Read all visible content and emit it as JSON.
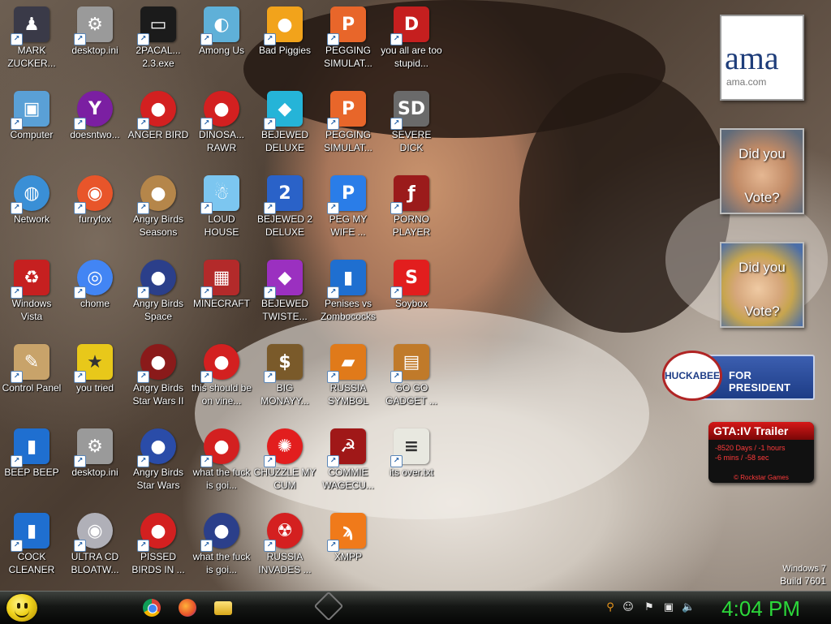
{
  "desktop": {
    "icons": [
      {
        "label": "MARK ZUCKER...",
        "icon": "hooded-figure-icon",
        "color": "#3a3a48",
        "glyph": "♟"
      },
      {
        "label": "desktop.ini",
        "icon": "ini-file-icon",
        "color": "#9a9a9a",
        "glyph": "⚙"
      },
      {
        "label": "2PACAL... 2.3.exe",
        "icon": "console-icon",
        "color": "#1b1b1b",
        "glyph": "▭"
      },
      {
        "label": "Among Us",
        "icon": "among-us-icon",
        "color": "#5fb0d8",
        "glyph": "◐"
      },
      {
        "label": "Bad Piggies",
        "icon": "bad-piggies-icon",
        "color": "#f2a31b",
        "glyph": "●"
      },
      {
        "label": "PEGGING SIMULAT...",
        "icon": "pegging-icon",
        "color": "#e8662a",
        "glyph": "P"
      },
      {
        "label": "you all are too stupid...",
        "icon": "dev-cpp-icon",
        "color": "#c51f1f",
        "glyph": "D"
      },
      {
        "label": "Computer",
        "icon": "computer-icon",
        "color": "#5aa0d6",
        "glyph": "▣"
      },
      {
        "label": "doesntwo...",
        "icon": "yahoo-messenger-icon",
        "color": "#7b1fa2",
        "glyph": "Y"
      },
      {
        "label": "ANGER BIRD",
        "icon": "angry-bird-icon",
        "color": "#d32020",
        "glyph": "●"
      },
      {
        "label": "DINOSA... RAWR",
        "icon": "angry-bird-icon",
        "color": "#d32020",
        "glyph": "●"
      },
      {
        "label": "BEJEWED DELUXE",
        "icon": "gem-icon",
        "color": "#25b4d8",
        "glyph": "◆"
      },
      {
        "label": "PEGGING SIMULAT...",
        "icon": "pegging-icon",
        "color": "#e8662a",
        "glyph": "P"
      },
      {
        "label": "SEVERE DICK",
        "icon": "sd-gear-icon",
        "color": "#6a6a6a",
        "glyph": "SD"
      },
      {
        "label": "Network",
        "icon": "network-globe-icon",
        "color": "#3a8fd6",
        "glyph": "◍"
      },
      {
        "label": "furryfox",
        "icon": "firefox-icon",
        "color": "#e8552a",
        "glyph": "◉"
      },
      {
        "label": "Angry Birds Seasons",
        "icon": "angry-birds-seasons-icon",
        "color": "#b5864a",
        "glyph": "●"
      },
      {
        "label": "LOUD HOUSE",
        "icon": "loud-house-icon",
        "color": "#7cc6f0",
        "glyph": "☃"
      },
      {
        "label": "BEJEWED 2 DELUXE",
        "icon": "bejeweled-2-icon",
        "color": "#2a62c8",
        "glyph": "2"
      },
      {
        "label": "PEG MY WIFE ...",
        "icon": "pegging-icon",
        "color": "#2a7de8",
        "glyph": "P"
      },
      {
        "label": "PORNO PLAYER",
        "icon": "flash-player-icon",
        "color": "#9b1b1b",
        "glyph": "ƒ"
      },
      {
        "label": "Windows Vista",
        "icon": "recycle-bin-icon",
        "color": "#c62020",
        "glyph": "♻"
      },
      {
        "label": "chome",
        "icon": "chrome-icon",
        "color": "#4285f4",
        "glyph": "◎"
      },
      {
        "label": "Angry Birds Space",
        "icon": "angry-birds-space-icon",
        "color": "#2b3f8a",
        "glyph": "●"
      },
      {
        "label": "MINECRAFT",
        "icon": "minecraft-icon",
        "color": "#b32a2a",
        "glyph": "▦"
      },
      {
        "label": "BEJEWED TWISTE...",
        "icon": "bejeweled-twist-icon",
        "color": "#9b30c0",
        "glyph": "◆"
      },
      {
        "label": "Penises vs Zombococks",
        "icon": "blue-book-icon",
        "color": "#1f6fd0",
        "glyph": "▮"
      },
      {
        "label": "Soybox",
        "icon": "soybox-icon",
        "color": "#e21e1e",
        "glyph": "S"
      },
      {
        "label": "Control Panel",
        "icon": "control-panel-icon",
        "color": "#c8a36a",
        "glyph": "✎"
      },
      {
        "label": "you tried",
        "icon": "gold-star-icon",
        "color": "#e8c81a",
        "glyph": "★"
      },
      {
        "label": "Angry Birds Star Wars II",
        "icon": "angry-birds-star-wars-2-icon",
        "color": "#8a1a1a",
        "glyph": "●"
      },
      {
        "label": "this should be on vine...",
        "icon": "angry-bird-icon",
        "color": "#d32020",
        "glyph": "●"
      },
      {
        "label": "BIG MONAYY...",
        "icon": "money-bag-icon",
        "color": "#7a5a2a",
        "glyph": "$"
      },
      {
        "label": "RUSSIA SYMBOL",
        "icon": "russia-symbol-icon",
        "color": "#e07a1a",
        "glyph": "▰"
      },
      {
        "label": "GO GO GADGET ...",
        "icon": "briefcase-icon",
        "color": "#c07a2a",
        "glyph": "▤"
      },
      {
        "label": "BEEP BEEP",
        "icon": "blue-book-icon",
        "color": "#1f6fd0",
        "glyph": "▮"
      },
      {
        "label": "desktop.ini",
        "icon": "ini-file-icon",
        "color": "#9a9a9a",
        "glyph": "⚙"
      },
      {
        "label": "Angry Birds Star Wars",
        "icon": "angry-birds-star-wars-icon",
        "color": "#2a4ca8",
        "glyph": "●"
      },
      {
        "label": "what the fuck is goi...",
        "icon": "angry-bird-icon",
        "color": "#d32020",
        "glyph": "●"
      },
      {
        "label": "CHUZZLE MY CUM",
        "icon": "chuzzle-icon",
        "color": "#e21e1e",
        "glyph": "✺"
      },
      {
        "label": "COMMIE WAGECU...",
        "icon": "commie-icon",
        "color": "#a01818",
        "glyph": "☭"
      },
      {
        "label": "its over.txt",
        "icon": "text-file-icon",
        "color": "#e8e8e0",
        "glyph": "≡"
      },
      {
        "label": "COCK CLEANER",
        "icon": "blue-book-icon",
        "color": "#1f6fd0",
        "glyph": "▮"
      },
      {
        "label": "ULTRA CD BLOATW...",
        "icon": "cd-disc-icon",
        "color": "#b0b0b8",
        "glyph": "◉"
      },
      {
        "label": "PISSED BIRDS IN ...",
        "icon": "angry-bird-icon",
        "color": "#d32020",
        "glyph": "●"
      },
      {
        "label": "what the fuck is goi...",
        "icon": "angry-birds-space-icon",
        "color": "#2b3f8a",
        "glyph": "●"
      },
      {
        "label": "RUSSIA INVADES ...",
        "icon": "radiation-icon",
        "color": "#d42020",
        "glyph": "☢"
      },
      {
        "label": "XMPP",
        "icon": "xampp-icon",
        "color": "#f07a1a",
        "glyph": "ϡ"
      }
    ]
  },
  "gadgets": {
    "ama": {
      "big": "ama",
      "small": "ama.com"
    },
    "vote1": {
      "line1": "Did you",
      "line2": "Vote?"
    },
    "vote2": {
      "line1": "Did you",
      "line2": "Vote?"
    },
    "huckabee": {
      "seal": "HUCKABEE",
      "text": "FOR PRESIDENT"
    },
    "gta": {
      "title": "GTA:IV Trailer",
      "line1": "-8520 Days / -1 hours",
      "line2": "-6 mins / -58 sec",
      "footer": "© Rockstar Games"
    }
  },
  "watermark": {
    "line1": "Windows 7",
    "line2": "Build 7601"
  },
  "taskbar": {
    "clock": "4:04 PM",
    "tray_icons": [
      "search-icon",
      "smiley-tray-icon",
      "action-center-flag-icon",
      "network-tray-icon",
      "speaker-icon"
    ],
    "tray_glyphs": [
      "⚲",
      "☺",
      "⚑",
      "▣",
      "🔈"
    ]
  }
}
